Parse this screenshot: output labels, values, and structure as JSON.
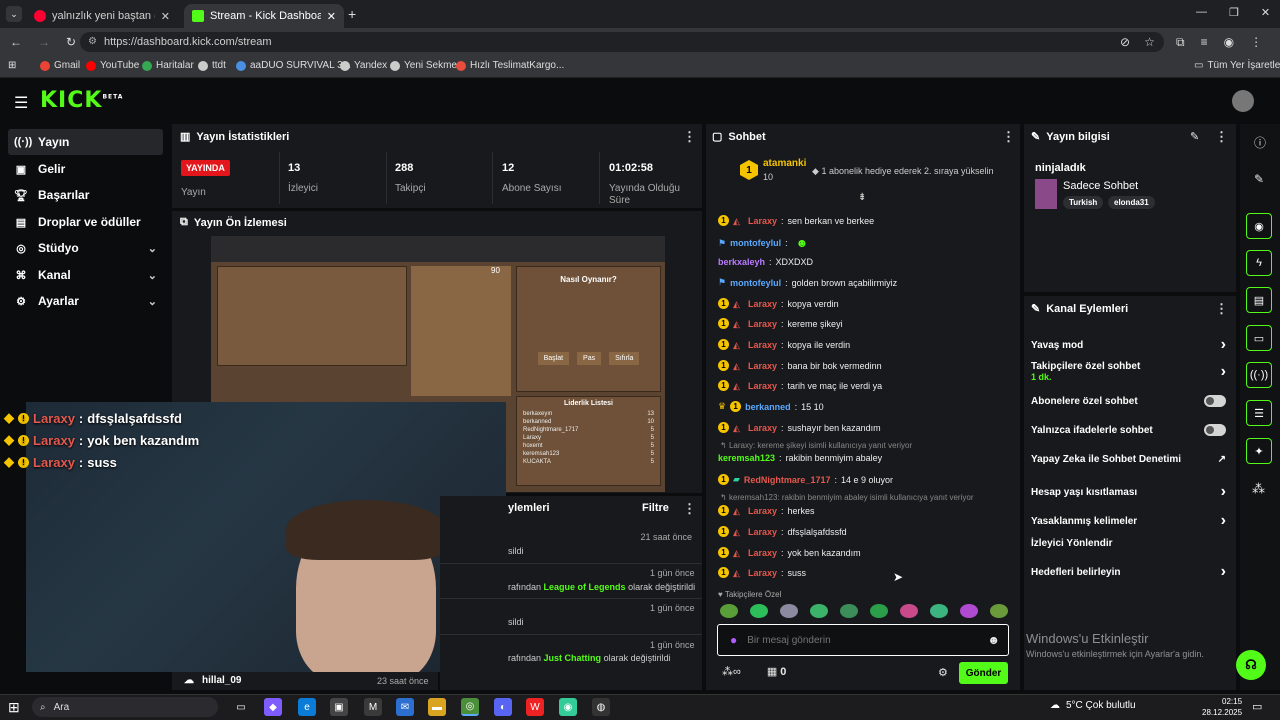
{
  "browser": {
    "tabs": [
      {
        "title": "yalnızlık yeni baştan (akusti",
        "active": false
      },
      {
        "title": "Stream - Kick Dashboard",
        "active": true
      }
    ],
    "new_tab": "+",
    "url": "https://dashboard.kick.com/stream",
    "bookmarks": [
      "Gmail",
      "YouTube",
      "Haritalar",
      "ttdt",
      "aaDUO SURVIVAL 3...",
      "Yandex",
      "Yeni Sekme",
      "Hızlı TeslimatKargo..."
    ],
    "all_bookmarks": "Tüm Yer İşaretleri"
  },
  "brand": {
    "logo": "KICK",
    "beta": "BETA",
    "accent": "#53fc18"
  },
  "sidebar": {
    "items": [
      {
        "label": "Yayın",
        "icon": "broadcast-icon",
        "active": true,
        "chevron": false
      },
      {
        "label": "Gelir",
        "icon": "wallet-icon",
        "active": false,
        "chevron": false
      },
      {
        "label": "Başarılar",
        "icon": "trophy-icon",
        "active": false,
        "chevron": false
      },
      {
        "label": "Droplar ve ödüller",
        "icon": "gift-icon",
        "active": false,
        "chevron": false
      },
      {
        "label": "Stüdyo",
        "icon": "studio-icon",
        "active": false,
        "chevron": true
      },
      {
        "label": "Kanal",
        "icon": "channel-icon",
        "active": false,
        "chevron": true
      },
      {
        "label": "Ayarlar",
        "icon": "gear-icon",
        "active": false,
        "chevron": true
      }
    ]
  },
  "stats": {
    "title": "Yayın İstatistikleri",
    "live_badge": "YAYINDA",
    "items": [
      {
        "value": "",
        "label": "Yayın"
      },
      {
        "value": "13",
        "label": "İzleyici"
      },
      {
        "value": "288",
        "label": "Takipçi"
      },
      {
        "value": "12",
        "label": "Abone Sayısı"
      },
      {
        "value": "01:02:58",
        "label": "Yayında Olduğu Süre"
      }
    ]
  },
  "preview": {
    "title": "Yayın Ön İzlemesi",
    "game_panel_title": "Nasıl Oynanır?",
    "buttons": [
      "Başlat",
      "Pas",
      "Sıfırla"
    ],
    "leaderboard_title": "Liderlik Listesi",
    "leaderboard": [
      {
        "name": "berkaxeyın",
        "score": "13"
      },
      {
        "name": "berkanned",
        "score": "10"
      },
      {
        "name": "RedNightmare_1717",
        "score": "5"
      },
      {
        "name": "Laraxy",
        "score": "5"
      },
      {
        "name": "hoxemt",
        "score": "5"
      },
      {
        "name": "keremsah123",
        "score": "5"
      },
      {
        "name": "KUCAKTA",
        "score": "5"
      }
    ],
    "timer": "90"
  },
  "overlay_chat": [
    {
      "user": "Laraxy",
      "text": "dfsşlalşafdssfd"
    },
    {
      "user": "Laraxy",
      "text": "yok ben kazandım"
    },
    {
      "user": "Laraxy",
      "text": "suss"
    }
  ],
  "events": {
    "title": "ylemleri",
    "filter": "Filtre",
    "rows": [
      {
        "time": "21 saat önce",
        "text": "sildi",
        "highlight": ""
      },
      {
        "time": "1 gün önce",
        "text": "rafından",
        "highlight": "League of Legends",
        "suffix": "olarak değiştirildi"
      },
      {
        "time": "1 gün önce",
        "text": "sildi",
        "highlight": ""
      },
      {
        "time": "1 gün önce",
        "text": "rafından",
        "highlight": "Just Chatting",
        "suffix": "olarak değiştirildi"
      }
    ],
    "bottom_user": "hillal_09",
    "bottom_time": "23 saat önce"
  },
  "chat": {
    "title": "Sohbet",
    "pinned_user": "atamanki",
    "pinned_count": "10",
    "pinned_rank": "1",
    "pinned_text": "1 abonelik hediye ederek 2. sıraya yükselin",
    "messages": [
      {
        "user": "Laraxy",
        "color": "r",
        "badges": "yr",
        "text": "sen berkan ve berkee"
      },
      {
        "user": "montofeylul",
        "color": "b",
        "badges": "k",
        "text": ""
      },
      {
        "user": "berkxaleyh",
        "color": "p",
        "badges": "",
        "text": "XDXDXD"
      },
      {
        "user": "montofeylul",
        "color": "b",
        "badges": "k",
        "text": "golden brown açabilirmiyiz"
      },
      {
        "user": "Laraxy",
        "color": "r",
        "badges": "yr",
        "text": "kopya verdin"
      },
      {
        "user": "Laraxy",
        "color": "r",
        "badges": "yr",
        "text": "kereme şikeyi"
      },
      {
        "user": "Laraxy",
        "color": "r",
        "badges": "yr",
        "text": "kopya ile verdin"
      },
      {
        "user": "Laraxy",
        "color": "r",
        "badges": "yr",
        "text": "bana bir bok vermedinn"
      },
      {
        "user": "Laraxy",
        "color": "r",
        "badges": "yr",
        "text": "tarih ve maç ile verdi ya"
      },
      {
        "user": "berkanned",
        "color": "b",
        "badges": "cy",
        "text": "15 10"
      },
      {
        "user": "Laraxy",
        "color": "r",
        "badges": "yr",
        "text": "sushayır ben kazandım"
      },
      {
        "reply": "Laraxy: kereme şikeyi isimli kullanıcıya yanıt veriyor"
      },
      {
        "user": "keremsah123",
        "color": "g",
        "badges": "",
        "text": "rakibin benmiyim abaley"
      },
      {
        "user": "RedNightmare_1717",
        "color": "r",
        "badges": "yg",
        "text": "14 e 9 oluyor"
      },
      {
        "reply": "keremsah123: rakibin benmiyim abaley isimli kullanıcıya yanıt veriyor"
      },
      {
        "user": "Laraxy",
        "color": "r",
        "badges": "yr",
        "text": "herkes"
      },
      {
        "user": "Laraxy",
        "color": "r",
        "badges": "yr",
        "text": "dfsşlalşafdssfd"
      },
      {
        "user": "Laraxy",
        "color": "r",
        "badges": "yr",
        "text": "yok ben kazandım"
      },
      {
        "user": "Laraxy",
        "color": "r",
        "badges": "yr",
        "text": "suss"
      }
    ],
    "followers_label": "Takipçilere Özel",
    "input_placeholder": "Bir mesaj gönderin",
    "points": "0",
    "send": "Gönder"
  },
  "stream_info": {
    "title": "Yayın bilgisi",
    "stream_title": "ninjaladık",
    "category": "Sadece Sohbet",
    "tags": [
      "Turkish",
      "elonda31"
    ]
  },
  "channel_actions": {
    "title": "Kanal Eylemleri",
    "items": [
      {
        "label": "Yavaş mod",
        "kind": "chevron",
        "sub": ""
      },
      {
        "label": "Takipçilere özel sohbet",
        "kind": "chevron",
        "sub": "1 dk."
      },
      {
        "label": "Abonelere özel sohbet",
        "kind": "toggle",
        "sub": ""
      },
      {
        "label": "Yalnızca ifadelerle sohbet",
        "kind": "toggle",
        "sub": ""
      },
      {
        "label": "Yapay Zeka ile Sohbet Denetimi",
        "kind": "external",
        "sub": ""
      },
      {
        "label": "Hesap yaşı kısıtlaması",
        "kind": "chevron",
        "sub": ""
      },
      {
        "label": "Yasaklanmış kelimeler",
        "kind": "chevron",
        "sub": ""
      },
      {
        "label": "İzleyici Yönlendir",
        "kind": "none",
        "sub": ""
      },
      {
        "label": "Hedefleri belirleyin",
        "kind": "chevron",
        "sub": ""
      }
    ]
  },
  "watermark": {
    "title": "Windows'u Etkinleştir",
    "sub": "Windows'u etkinleştirmek için Ayarlar'a gidin."
  },
  "taskbar": {
    "search": "Ara",
    "weather": "5°C  Çok bulutlu",
    "time": "02:15",
    "date": "28.12.2025"
  }
}
